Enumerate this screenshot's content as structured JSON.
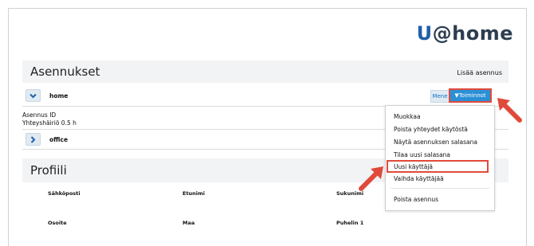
{
  "logo": {
    "u": "U",
    "rest": "@home"
  },
  "installations": {
    "title": "Asennukset",
    "add_link": "Lisää asennus",
    "items": [
      {
        "name": "home",
        "expanded": true
      },
      {
        "name": "office",
        "expanded": false
      }
    ],
    "detail": {
      "id_label": "Asennus ID",
      "status": "Yhteyshäiriö 0.5 h"
    },
    "go_button": "Mene",
    "actions_button": "▼Toiminnot"
  },
  "actions_menu": [
    "Muokkaa",
    "Poista yhteydet käytöstä",
    "Näytä asennuksen salasana",
    "Tilaa uusi salasana",
    "Uusi käyttäjä",
    "Vaihda käyttäjää",
    "Poista asennus"
  ],
  "profile": {
    "title": "Profiili",
    "fields": [
      "Sähköposti",
      "Etunimi",
      "Sukunimi",
      "Osoite",
      "Maa",
      "Puhelin 1"
    ]
  },
  "colors": {
    "highlight": "#e04a3a",
    "accent": "#2b8fd6",
    "logo_u": "#1f5fa8"
  },
  "icons": {
    "expanded": "chevron-down-icon",
    "collapsed": "chevron-right-icon",
    "pointer": "pointer-arrow-icon"
  }
}
